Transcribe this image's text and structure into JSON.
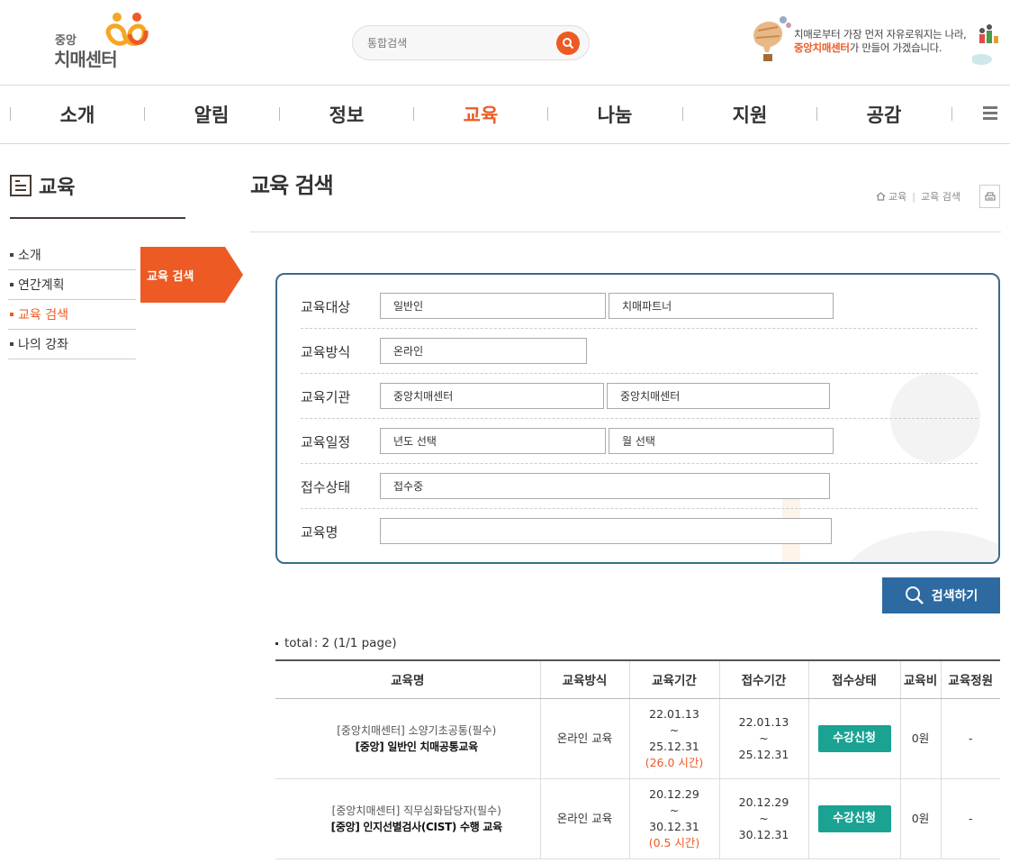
{
  "header": {
    "logo_small": "중앙",
    "logo_big": "치매센터",
    "search_placeholder": "통합검색",
    "slogan_line1": "치매로부터 가장 먼저 자유로워지는 나라,",
    "slogan_highlight": "중앙치매센터",
    "slogan_line2_rest": "가 만들어 가겠습니다.",
    "accent_color": "#ee5a24"
  },
  "gnb": {
    "items": [
      "소개",
      "알림",
      "정보",
      "교육",
      "나눔",
      "지원",
      "공감"
    ],
    "active": "교육",
    "menu_icon": "hamburger-icon"
  },
  "sidebar": {
    "title": "교육",
    "items": [
      {
        "label": "소개"
      },
      {
        "label": "연간계획"
      },
      {
        "label": "교육 검색"
      },
      {
        "label": "나의 강좌"
      }
    ],
    "active_flag": "교육 검색"
  },
  "main": {
    "title": "교육 검색",
    "breadcrumb": [
      "교육",
      "교육 검색"
    ]
  },
  "form": {
    "target_label": "교육대상",
    "target_value1": "일반인",
    "target_value2": "치매파트너",
    "method_label": "교육방식",
    "method_value": "온라인",
    "org_label": "교육기관",
    "org_value1": "중앙치매센터",
    "org_value2": "중앙치매센터",
    "schedule_label": "교육일정",
    "schedule_year": "년도 선택",
    "schedule_month": "월 선택",
    "status_label": "접수상태",
    "status_value": "접수중",
    "name_label": "교육명",
    "name_value": "",
    "search_button": "검색하기"
  },
  "results": {
    "total_label": "total",
    "total_value": "2 (1/1 page)",
    "columns": [
      "교육명",
      "교육방식",
      "교육기간",
      "접수기간",
      "접수상태",
      "교육비",
      "교육정원"
    ],
    "rows": [
      {
        "sub": "[중앙치매센터] 소양기초공통(필수)",
        "main": "[중앙] 일반인 치매공통교육",
        "method": "온라인 교육",
        "edu_start": "22.01.13",
        "edu_end": "25.12.31",
        "hours": "(26.0 시간)",
        "reg_start": "22.01.13",
        "reg_end": "25.12.31",
        "status": "수강신청",
        "fee": "0원",
        "capacity": "-"
      },
      {
        "sub": "[중앙치매센터] 직무심화담당자(필수)",
        "main": "[중앙] 인지선별검사(CIST) 수행 교육",
        "method": "온라인 교육",
        "edu_start": "20.12.29",
        "edu_end": "30.12.31",
        "hours": "(0.5 시간)",
        "reg_start": "20.12.29",
        "reg_end": "30.12.31",
        "status": "수강신청",
        "fee": "0원",
        "capacity": "-"
      }
    ],
    "tilde": "~"
  }
}
